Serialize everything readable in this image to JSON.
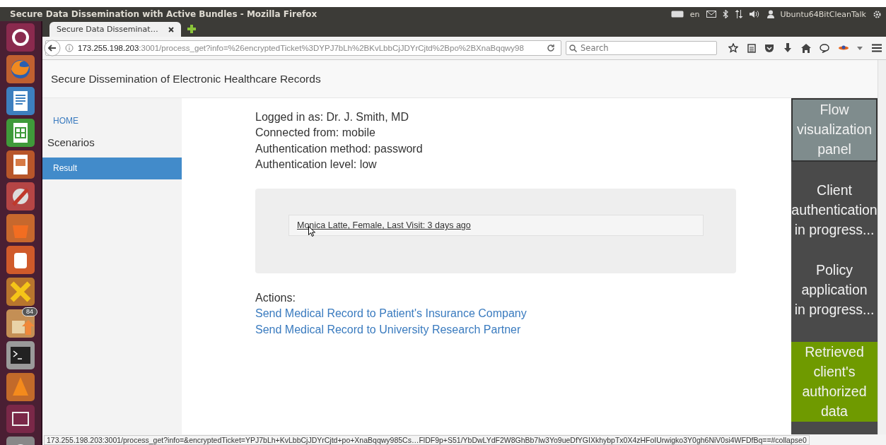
{
  "os_title": "Secure Data Dissemination with Active Bundles - Mozilla Firefox",
  "indicators": {
    "keyboard": "en",
    "user": "Ubuntu64BitCleanTalk"
  },
  "launcher": {
    "badge": "84"
  },
  "tabs": [
    {
      "label": "Secure Data Disseminat…",
      "selected": true
    }
  ],
  "address_bar": {
    "host": "173.255.198.203",
    "path": ":3001/process_get?info=%26encryptedTicket%3DYPJ7bLh%2BKvLbbCjJDYrCjtd%2Bpo%2BXnaBqqwy98"
  },
  "search": {
    "placeholder": "Search"
  },
  "page": {
    "title": "Secure Dissemination of Electronic Healthcare Records",
    "sidebar": [
      {
        "label": "HOME",
        "kind": "link",
        "selected": false
      },
      {
        "label": "Scenarios",
        "kind": "heading",
        "selected": false
      },
      {
        "label": "Result",
        "kind": "link",
        "selected": true
      }
    ],
    "info": [
      "Logged in as: Dr. J. Smith, MD",
      "Connected from: mobile",
      "Authentication method: password",
      "Authentication level: low"
    ],
    "record": "Monica Latte, Female, Last Visit: 3 days ago",
    "actions_label": "Actions:",
    "actions": [
      "Send Medical Record to Patient's Insurance Company",
      "Send Medical Record to University Research Partner"
    ]
  },
  "flow_panel": [
    {
      "text": "Flow\nvisualization\npanel",
      "kind": "header"
    },
    {
      "text": "Client\nauthentication\nin progress...",
      "kind": "pending"
    },
    {
      "text": "Policy\napplication\nin progress...",
      "kind": "pending"
    },
    {
      "text": "Retrieved\nclient's\nauthorized\ndata",
      "kind": "done"
    }
  ],
  "status_url": "173.255.198.203:3001/process_get?info=&encryptedTicket=YPJ7bLh+KvLbbCjJDYrCjtd+po+XnaBqqwy985Cs…FlDF9p+S51/YbDwLYdF2W8GhBb7lw3Yo9ueDfYGIXkhybpTx0X4zHFoIUrwigko3Y0gh6NiV0si4WFDfBq==#collapse0"
}
